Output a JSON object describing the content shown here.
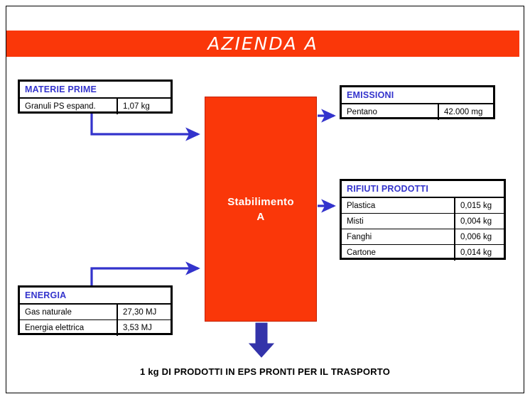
{
  "page": {
    "title": "AZIENDA A",
    "caption": "1 kg DI PRODOTTI IN EPS PRONTI PER IL TRASPORTO"
  },
  "colors": {
    "accent_red": "#FA3709",
    "header_blue": "#3333CC",
    "arrow_blue": "#3333CC",
    "thick_arrow_blue": "#3333AA",
    "border_black": "#000000",
    "background": "#FFFFFF"
  },
  "plant": {
    "label_line1": "Stabilimento",
    "label_line2": "A"
  },
  "boxes": {
    "materie_prime": {
      "header": "MATERIE PRIME",
      "rows": [
        {
          "label": "Granuli PS espand.",
          "value": "1,07 kg"
        }
      ]
    },
    "energia": {
      "header": "ENERGIA",
      "rows": [
        {
          "label": "Gas naturale",
          "value": "27,30 MJ"
        },
        {
          "label": "Energia elettrica",
          "value": "3,53 MJ"
        }
      ]
    },
    "emissioni": {
      "header": "EMISSIONI",
      "rows": [
        {
          "label": "Pentano",
          "value": "42.000 mg"
        }
      ]
    },
    "rifiuti_prodotti": {
      "header": "RIFIUTI PRODOTTI",
      "rows": [
        {
          "label": "Plastica",
          "value": "0,015 kg"
        },
        {
          "label": "Misti",
          "value": "0,004 kg"
        },
        {
          "label": "Fanghi",
          "value": "0,006 kg"
        },
        {
          "label": "Cartone",
          "value": "0,014 kg"
        }
      ]
    }
  },
  "arrows": [
    {
      "name": "materie-prime-to-plant",
      "direction": "right"
    },
    {
      "name": "energia-to-plant",
      "direction": "right"
    },
    {
      "name": "plant-to-emissioni",
      "direction": "right"
    },
    {
      "name": "plant-to-rifiuti",
      "direction": "right"
    },
    {
      "name": "plant-to-output",
      "direction": "down"
    }
  ]
}
